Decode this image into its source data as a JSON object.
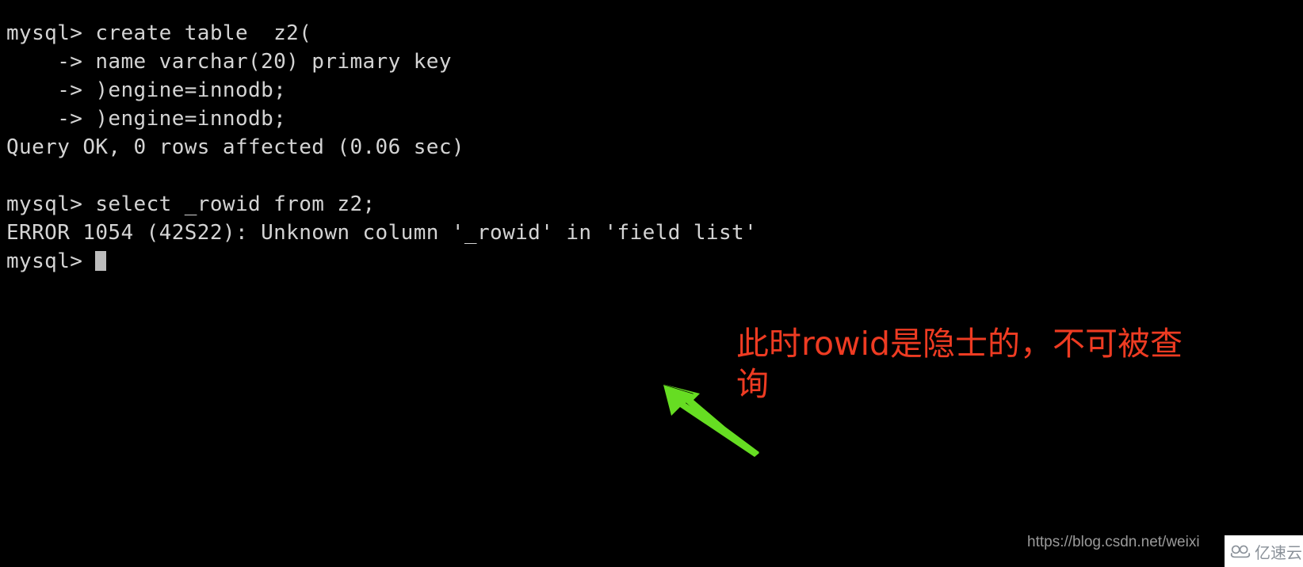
{
  "terminal": {
    "lines": [
      {
        "text": "mysql> create table  z2("
      },
      {
        "text": "    -> name varchar(20) primary key"
      },
      {
        "text": "    -> )engine=innodb;"
      },
      {
        "text": "    -> )engine=innodb;"
      },
      {
        "text": "Query OK, 0 rows affected (0.06 sec)"
      },
      {
        "text": ""
      },
      {
        "text": "mysql> select _rowid from z2;"
      },
      {
        "text": "ERROR 1054 (42S22): Unknown column '_rowid' in 'field list'"
      }
    ],
    "prompt": "mysql> ",
    "text_color": "#d4d4d4",
    "background_color": "#000000",
    "cursor_color": "#bdbdbd"
  },
  "annotation": {
    "text": "此时rowid是隐士的，不可被查询",
    "color": "#ee3b22"
  },
  "arrow": {
    "color": "#66dd22",
    "direction": "up-left",
    "name": "green-pointer-arrow"
  },
  "watermark": {
    "url": "https://blog.csdn.net/weixi",
    "logo_text": "亿速云",
    "logo_icon": "cloud-icon",
    "url_color": "#9a9a9a",
    "badge_background": "#ffffff"
  }
}
